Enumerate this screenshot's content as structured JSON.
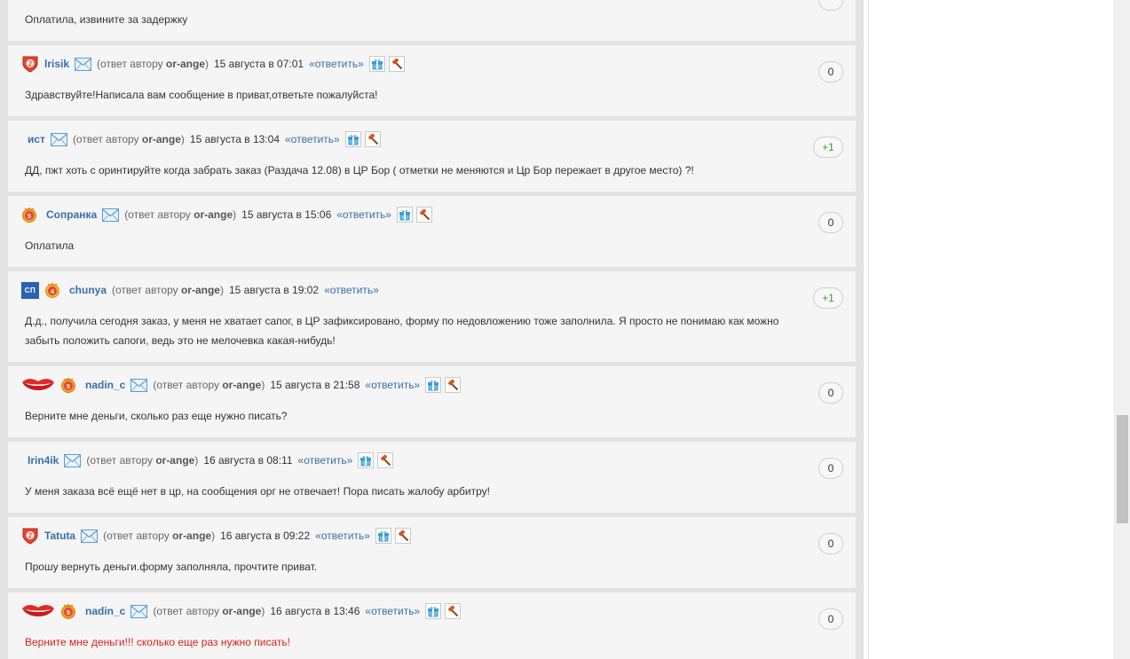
{
  "reply_label": "«ответить»",
  "reply_prefix": "(ответ автору",
  "reply_author": "or-ange",
  "reply_suffix": ")",
  "comments": [
    {
      "body": "Оплатила, извините за задержку",
      "score": ""
    },
    {
      "user": "lrisik",
      "date": "15 августа в 07:01",
      "body": "Здравствуйте!Написала вам сообщение в приват,ответьте пожалуйста!",
      "score": "0",
      "badge": "shield-2-badge-icon"
    },
    {
      "user": "ист",
      "date": "15 августа в 13:04",
      "body": "ДД, пжт хоть с оринтируйте когда забрать заказ (Раздача 12.08) в ЦР Бор ( отметки не меняются и Цр Бор пережает в другое место) ?!",
      "score": "+1"
    },
    {
      "user": "Сопранка",
      "date": "15 августа в 15:06",
      "body": "Оплатила",
      "score": "0",
      "badge": "medal-5-badge-icon"
    },
    {
      "user": "chunya",
      "date": "15 августа в 19:02",
      "body": "Д.д., получила сегодня заказ, у меня не хватает сапог, в ЦР зафиксировано, форму по недовложению тоже заполнила. Я просто не понимаю как можно забыть положить сапоги, ведь это не мелочевка какая-нибудь!",
      "score": "+1",
      "badge": "medal-4-badge-icon",
      "logo_text": "СП"
    },
    {
      "user": "nadin_c",
      "date": "15 августа в 21:58",
      "body": "Верните мне деньги, сколько раз еще нужно писать?",
      "score": "0",
      "badge": "medal-5-badge-icon"
    },
    {
      "user": "Irin4ik",
      "date": "16 августа в 08:11",
      "body": "У меня заказа всё ещё нет в цр, на сообщения орг не отвечает! Пора писать жалобу арбитру!",
      "score": "0"
    },
    {
      "user": "Tatuta",
      "date": "16 августа в 09:22",
      "body": "Прошу вернуть деньги.форму заполняла, прочтите приват.",
      "score": "0",
      "badge": "shield-2-badge-icon"
    },
    {
      "user": "nadin_c",
      "date": "16 августа в 13:46",
      "body": "Верните мне деньги!!! сколько еще раз нужно писать!",
      "score": "0",
      "badge": "medal-5-badge-icon"
    }
  ],
  "colors": {
    "username": "#3a6ea5",
    "positive_score": "#3d9a3d",
    "alert_text": "#e0201b",
    "card_bg": "#f5f5f5",
    "feed_bg": "#e3e3e3"
  }
}
